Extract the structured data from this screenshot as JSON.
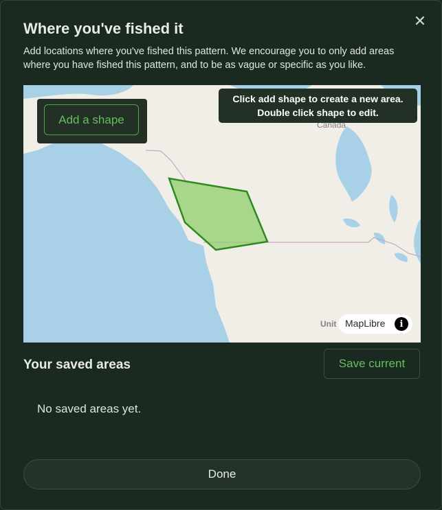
{
  "dialog": {
    "title": "Where you've fished it",
    "description": "Add locations where you've fished this pattern. We encourage you to only add areas where you have fished this pattern, and to be as vague or specific as you like.",
    "close_icon": "close-icon"
  },
  "map": {
    "add_shape_label": "Add a shape",
    "hint_line1": "Click add shape to create a new area.",
    "hint_line2": "Double click shape to edit.",
    "country_label": "Canada",
    "unit_label": "Unit",
    "attribution": "MapLibre",
    "info_symbol": "i",
    "colors": {
      "water": "#a8d1e7",
      "land": "#f1eee8",
      "polygon_fill": "#8fcf6e",
      "polygon_stroke": "#2e8a1e"
    }
  },
  "saved": {
    "title": "Your saved areas",
    "save_label": "Save current",
    "empty_text": "No saved areas yet."
  },
  "footer": {
    "done_label": "Done"
  }
}
